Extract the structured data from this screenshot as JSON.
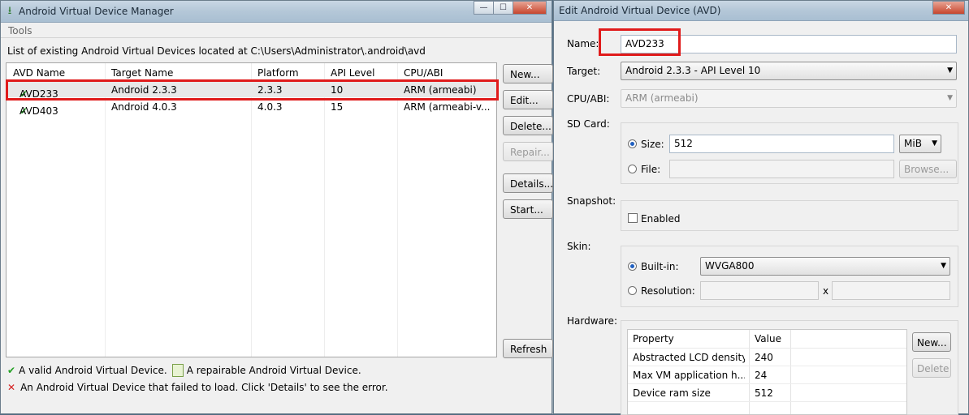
{
  "manager": {
    "title": "Android Virtual Device Manager",
    "menu": {
      "tools": "Tools"
    },
    "list_label": "List of existing Android Virtual Devices located at C:\\Users\\Administrator\\.android\\avd",
    "columns": [
      "AVD Name",
      "Target Name",
      "Platform",
      "API Level",
      "CPU/ABI"
    ],
    "rows": [
      {
        "name": "AVD233",
        "target": "Android 2.3.3",
        "platform": "2.3.3",
        "api": "10",
        "cpu": "ARM (armeabi)",
        "selected": true
      },
      {
        "name": "AVD403",
        "target": "Android 4.0.3",
        "platform": "4.0.3",
        "api": "15",
        "cpu": "ARM (armeabi-v...",
        "selected": false
      }
    ],
    "buttons": {
      "new": "New...",
      "edit": "Edit...",
      "delete": "Delete...",
      "repair": "Repair...",
      "details": "Details...",
      "start": "Start...",
      "refresh": "Refresh"
    },
    "legend": {
      "valid": "A valid Android Virtual Device.",
      "repairable": "A repairable Android Virtual Device.",
      "failed": "An Android Virtual Device that failed to load. Click 'Details' to see the error."
    }
  },
  "edit": {
    "title": "Edit Android Virtual Device (AVD)",
    "name_label": "Name:",
    "name_value": "AVD233",
    "target_label": "Target:",
    "target_value": "Android 2.3.3 - API Level 10",
    "cpu_label": "CPU/ABI:",
    "cpu_value": "ARM (armeabi)",
    "sdcard_label": "SD Card:",
    "size_label": "Size:",
    "size_value": "512",
    "size_unit": "MiB",
    "file_label": "File:",
    "file_value": "",
    "browse": "Browse...",
    "snapshot_label": "Snapshot:",
    "enabled_label": "Enabled",
    "skin_label": "Skin:",
    "builtin_label": "Built-in:",
    "builtin_value": "WVGA800",
    "resolution_label": "Resolution:",
    "res_x": "x",
    "hardware_label": "Hardware:",
    "hw_columns": [
      "Property",
      "Value"
    ],
    "hw_rows": [
      {
        "property": "Abstracted LCD density",
        "value": "240"
      },
      {
        "property": "Max VM application h...",
        "value": "24"
      },
      {
        "property": "Device ram size",
        "value": "512"
      }
    ],
    "hw_new": "New...",
    "hw_delete": "Delete"
  },
  "colors": {
    "highlight": "#e01b1b",
    "valid_check": "#22a022",
    "error_x": "#d42020"
  },
  "window_controls": {
    "minimize": "—",
    "maximize": "☐",
    "close": "✕"
  }
}
